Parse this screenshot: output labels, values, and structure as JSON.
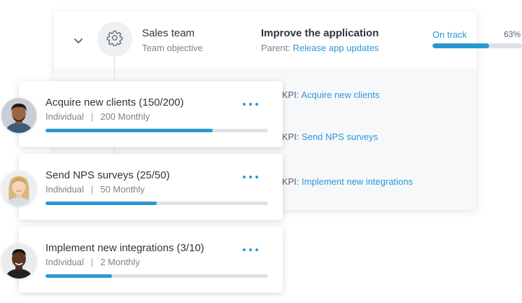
{
  "objective": {
    "team_name": "Sales team",
    "team_subtitle": "Team objective",
    "goal_title": "Improve the application",
    "parent_label": "Parent:",
    "parent_link": "Release app updates",
    "status": "On track",
    "progress_text": "63%",
    "progress": 0.63
  },
  "kpi_rows": [
    {
      "prefix": "d KPI:",
      "link": "Acquire new clients"
    },
    {
      "prefix": "d KPI:",
      "link": "Send NPS surveys"
    },
    {
      "prefix": "d KPI:",
      "link": "Implement new integrations"
    }
  ],
  "key_results": [
    {
      "title": "Acquire new clients (150/200)",
      "type": "Individual",
      "separator": "|",
      "target": "200 Monthly",
      "progress": 0.75
    },
    {
      "title": "Send NPS surveys (25/50)",
      "type": "Individual",
      "separator": "|",
      "target": "50 Monthly",
      "progress": 0.5
    },
    {
      "title": "Implement new integrations (3/10)",
      "type": "Individual",
      "separator": "|",
      "target": "2 Monthly",
      "progress": 0.3
    }
  ],
  "icons": {
    "expand": "chevron-down-icon",
    "objective": "gear-icon",
    "more": "more-dots-icon"
  },
  "colors": {
    "accent": "#2a97d6",
    "track": "#dde2e7",
    "text": "#2f3440",
    "muted": "#7b828c"
  }
}
